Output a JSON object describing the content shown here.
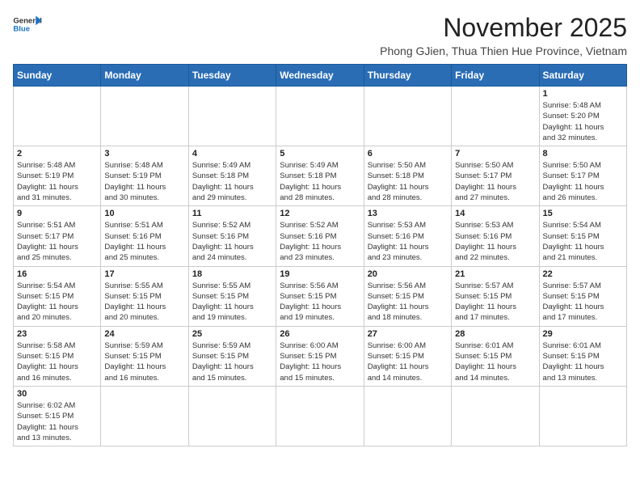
{
  "header": {
    "logo_line1": "General",
    "logo_line2": "Blue",
    "month": "November 2025",
    "location": "Phong GJien, Thua Thien Hue Province, Vietnam"
  },
  "weekdays": [
    "Sunday",
    "Monday",
    "Tuesday",
    "Wednesday",
    "Thursday",
    "Friday",
    "Saturday"
  ],
  "weeks": [
    [
      {
        "day": "",
        "info": ""
      },
      {
        "day": "",
        "info": ""
      },
      {
        "day": "",
        "info": ""
      },
      {
        "day": "",
        "info": ""
      },
      {
        "day": "",
        "info": ""
      },
      {
        "day": "",
        "info": ""
      },
      {
        "day": "1",
        "info": "Sunrise: 5:48 AM\nSunset: 5:20 PM\nDaylight: 11 hours\nand 32 minutes."
      }
    ],
    [
      {
        "day": "2",
        "info": "Sunrise: 5:48 AM\nSunset: 5:19 PM\nDaylight: 11 hours\nand 31 minutes."
      },
      {
        "day": "3",
        "info": "Sunrise: 5:48 AM\nSunset: 5:19 PM\nDaylight: 11 hours\nand 30 minutes."
      },
      {
        "day": "4",
        "info": "Sunrise: 5:49 AM\nSunset: 5:18 PM\nDaylight: 11 hours\nand 29 minutes."
      },
      {
        "day": "5",
        "info": "Sunrise: 5:49 AM\nSunset: 5:18 PM\nDaylight: 11 hours\nand 28 minutes."
      },
      {
        "day": "6",
        "info": "Sunrise: 5:50 AM\nSunset: 5:18 PM\nDaylight: 11 hours\nand 28 minutes."
      },
      {
        "day": "7",
        "info": "Sunrise: 5:50 AM\nSunset: 5:17 PM\nDaylight: 11 hours\nand 27 minutes."
      },
      {
        "day": "8",
        "info": "Sunrise: 5:50 AM\nSunset: 5:17 PM\nDaylight: 11 hours\nand 26 minutes."
      }
    ],
    [
      {
        "day": "9",
        "info": "Sunrise: 5:51 AM\nSunset: 5:17 PM\nDaylight: 11 hours\nand 25 minutes."
      },
      {
        "day": "10",
        "info": "Sunrise: 5:51 AM\nSunset: 5:16 PM\nDaylight: 11 hours\nand 25 minutes."
      },
      {
        "day": "11",
        "info": "Sunrise: 5:52 AM\nSunset: 5:16 PM\nDaylight: 11 hours\nand 24 minutes."
      },
      {
        "day": "12",
        "info": "Sunrise: 5:52 AM\nSunset: 5:16 PM\nDaylight: 11 hours\nand 23 minutes."
      },
      {
        "day": "13",
        "info": "Sunrise: 5:53 AM\nSunset: 5:16 PM\nDaylight: 11 hours\nand 23 minutes."
      },
      {
        "day": "14",
        "info": "Sunrise: 5:53 AM\nSunset: 5:16 PM\nDaylight: 11 hours\nand 22 minutes."
      },
      {
        "day": "15",
        "info": "Sunrise: 5:54 AM\nSunset: 5:15 PM\nDaylight: 11 hours\nand 21 minutes."
      }
    ],
    [
      {
        "day": "16",
        "info": "Sunrise: 5:54 AM\nSunset: 5:15 PM\nDaylight: 11 hours\nand 20 minutes."
      },
      {
        "day": "17",
        "info": "Sunrise: 5:55 AM\nSunset: 5:15 PM\nDaylight: 11 hours\nand 20 minutes."
      },
      {
        "day": "18",
        "info": "Sunrise: 5:55 AM\nSunset: 5:15 PM\nDaylight: 11 hours\nand 19 minutes."
      },
      {
        "day": "19",
        "info": "Sunrise: 5:56 AM\nSunset: 5:15 PM\nDaylight: 11 hours\nand 19 minutes."
      },
      {
        "day": "20",
        "info": "Sunrise: 5:56 AM\nSunset: 5:15 PM\nDaylight: 11 hours\nand 18 minutes."
      },
      {
        "day": "21",
        "info": "Sunrise: 5:57 AM\nSunset: 5:15 PM\nDaylight: 11 hours\nand 17 minutes."
      },
      {
        "day": "22",
        "info": "Sunrise: 5:57 AM\nSunset: 5:15 PM\nDaylight: 11 hours\nand 17 minutes."
      }
    ],
    [
      {
        "day": "23",
        "info": "Sunrise: 5:58 AM\nSunset: 5:15 PM\nDaylight: 11 hours\nand 16 minutes."
      },
      {
        "day": "24",
        "info": "Sunrise: 5:59 AM\nSunset: 5:15 PM\nDaylight: 11 hours\nand 16 minutes."
      },
      {
        "day": "25",
        "info": "Sunrise: 5:59 AM\nSunset: 5:15 PM\nDaylight: 11 hours\nand 15 minutes."
      },
      {
        "day": "26",
        "info": "Sunrise: 6:00 AM\nSunset: 5:15 PM\nDaylight: 11 hours\nand 15 minutes."
      },
      {
        "day": "27",
        "info": "Sunrise: 6:00 AM\nSunset: 5:15 PM\nDaylight: 11 hours\nand 14 minutes."
      },
      {
        "day": "28",
        "info": "Sunrise: 6:01 AM\nSunset: 5:15 PM\nDaylight: 11 hours\nand 14 minutes."
      },
      {
        "day": "29",
        "info": "Sunrise: 6:01 AM\nSunset: 5:15 PM\nDaylight: 11 hours\nand 13 minutes."
      }
    ],
    [
      {
        "day": "30",
        "info": "Sunrise: 6:02 AM\nSunset: 5:15 PM\nDaylight: 11 hours\nand 13 minutes."
      },
      {
        "day": "",
        "info": ""
      },
      {
        "day": "",
        "info": ""
      },
      {
        "day": "",
        "info": ""
      },
      {
        "day": "",
        "info": ""
      },
      {
        "day": "",
        "info": ""
      },
      {
        "day": "",
        "info": ""
      }
    ]
  ]
}
